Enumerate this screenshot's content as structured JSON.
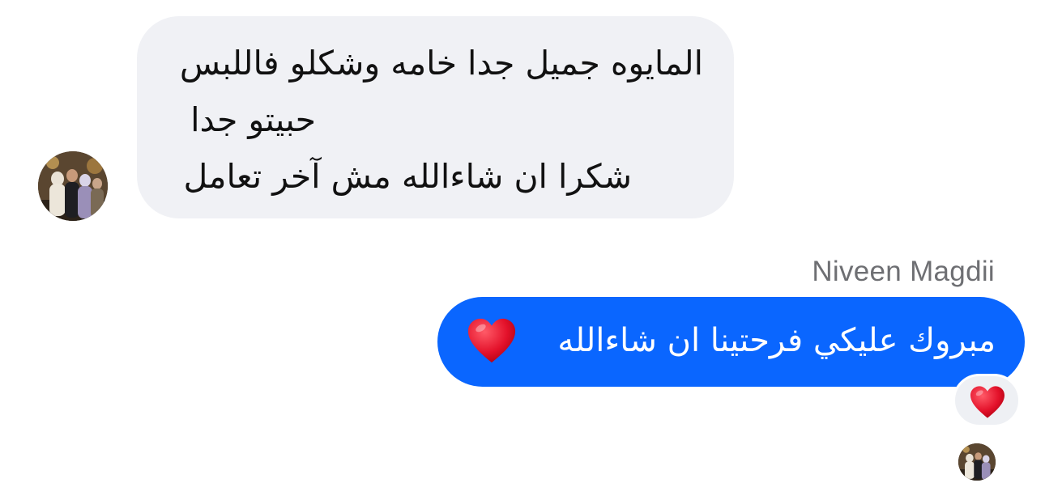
{
  "incoming": {
    "lines": [
      "المايوه جميل جدا خامه وشكلو فاللبس",
      "حبيتو جدا",
      "شكرا ان شاءالله مش آخر تعامل"
    ],
    "bubble_color": "#f0f1f5"
  },
  "outgoing": {
    "sender_name": "Niveen Magdii",
    "text": "مبروك عليكي فرحتينا ان شاءالله",
    "emoji": "heart-emoji",
    "bubble_color": "#0a66ff"
  },
  "reaction": {
    "emoji": "heart-emoji"
  },
  "colors": {
    "accent": "#0a66ff",
    "heart": "#e3112a"
  }
}
